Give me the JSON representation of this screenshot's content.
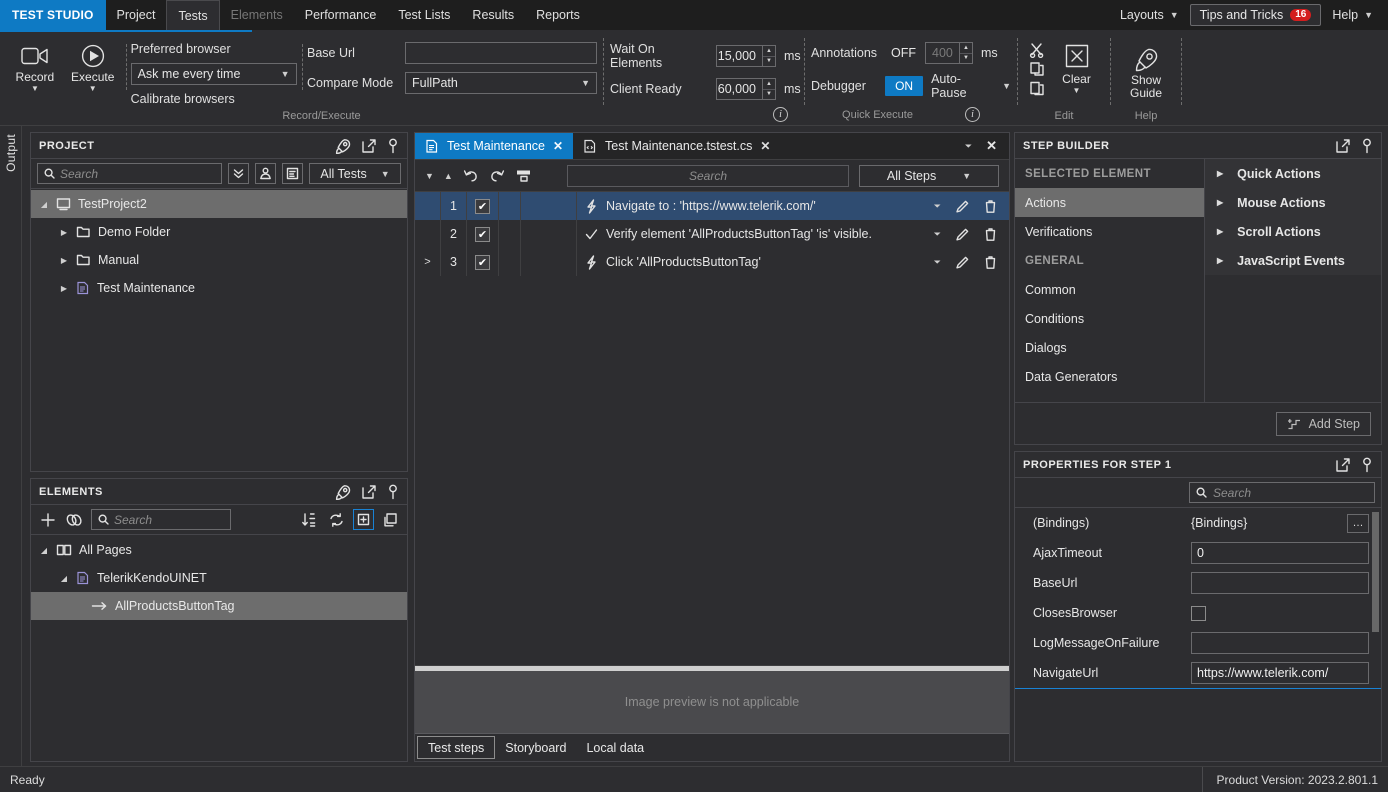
{
  "app": {
    "brand": "TEST STUDIO",
    "status_left": "Ready",
    "status_right": "Product Version: 2023.2.801.1"
  },
  "menu": {
    "items": [
      {
        "label": "Project",
        "state": "normal"
      },
      {
        "label": "Tests",
        "state": "active"
      },
      {
        "label": "Elements",
        "state": "disabled"
      },
      {
        "label": "Performance",
        "state": "normal"
      },
      {
        "label": "Test Lists",
        "state": "normal"
      },
      {
        "label": "Results",
        "state": "normal"
      },
      {
        "label": "Reports",
        "state": "normal"
      }
    ],
    "layouts_label": "Layouts",
    "tips_label": "Tips and Tricks",
    "tips_count": "16",
    "help_label": "Help"
  },
  "ribbon": {
    "record": {
      "label": "Record"
    },
    "execute": {
      "label": "Execute"
    },
    "browser": {
      "preferred_label": "Preferred browser",
      "preferred_value": "Ask me every time",
      "calibrate_label": "Calibrate browsers"
    },
    "urls": {
      "base_url_label": "Base Url",
      "base_url_value": "",
      "compare_mode_label": "Compare Mode",
      "compare_mode_value": "FullPath"
    },
    "timeouts": {
      "wait_label": "Wait On Elements",
      "wait_value": "15,000",
      "wait_unit": "ms",
      "client_label": "Client Ready",
      "client_value": "60,000",
      "client_unit": "ms"
    },
    "quick": {
      "annotations_label": "Annotations",
      "annotations_value": "OFF",
      "annotations_delay": "400",
      "annotations_unit": "ms",
      "debugger_label": "Debugger",
      "debugger_value": "ON",
      "autopause_label": "Auto-Pause"
    },
    "edit": {
      "clear_label": "Clear",
      "group_label": "Edit"
    },
    "help": {
      "show_guide_label": "Show\nGuide",
      "show_guide_line1": "Show",
      "show_guide_line2": "Guide",
      "group_label": "Help"
    },
    "group_labels": {
      "record_execute": "Record/Execute",
      "quick_execute": "Quick Execute"
    }
  },
  "output_rail": {
    "label": "Output"
  },
  "project_panel": {
    "title": "PROJECT",
    "search_placeholder": "Search",
    "filter_value": "All Tests",
    "tree": [
      {
        "label": "TestProject2",
        "icon": "project-icon",
        "depth": 0,
        "selected": true,
        "twisty": "open"
      },
      {
        "label": "Demo Folder",
        "icon": "folder-icon",
        "depth": 1,
        "selected": false,
        "twisty": "closed"
      },
      {
        "label": "Manual",
        "icon": "folder-icon",
        "depth": 1,
        "selected": false,
        "twisty": "closed"
      },
      {
        "label": "Test Maintenance",
        "icon": "test-icon",
        "depth": 1,
        "selected": false,
        "twisty": "closed"
      }
    ]
  },
  "elements_panel": {
    "title": "ELEMENTS",
    "search_placeholder": "Search",
    "tree": [
      {
        "label": "All Pages",
        "icon": "book-icon",
        "depth": 0,
        "selected": false,
        "twisty": "open"
      },
      {
        "label": "TelerikKendoUINET",
        "icon": "page-icon",
        "depth": 1,
        "selected": false,
        "twisty": "open"
      },
      {
        "label": "AllProductsButtonTag",
        "icon": "arrow-icon",
        "depth": 2,
        "selected": true,
        "twisty": "none"
      }
    ]
  },
  "center": {
    "tabs": [
      {
        "label": "Test Maintenance",
        "active": true,
        "icon": "test-file-icon"
      },
      {
        "label": "Test Maintenance.tstest.cs",
        "active": false,
        "icon": "code-file-icon"
      }
    ],
    "steps_search_placeholder": "Search",
    "steps_filter_value": "All Steps",
    "steps": [
      {
        "num": "1",
        "checked": true,
        "icon": "lightning-icon",
        "text": "Navigate to : 'https://www.telerik.com/'",
        "selected": true,
        "expander": false
      },
      {
        "num": "2",
        "checked": true,
        "icon": "check-icon",
        "text": "Verify element 'AllProductsButtonTag' 'is' visible.",
        "selected": false,
        "expander": false
      },
      {
        "num": "3",
        "checked": true,
        "icon": "lightning-icon",
        "text": "Click 'AllProductsButtonTag'",
        "selected": false,
        "expander": true
      }
    ],
    "preview_text": "Image preview is not applicable",
    "bottom_tabs": [
      {
        "label": "Test steps",
        "active": true
      },
      {
        "label": "Storyboard",
        "active": false
      },
      {
        "label": "Local data",
        "active": false
      }
    ]
  },
  "step_builder": {
    "title": "STEP BUILDER",
    "categories": [
      {
        "label": "SELECTED ELEMENT",
        "type": "header"
      },
      {
        "label": "Actions",
        "type": "item",
        "selected": true
      },
      {
        "label": "Verifications",
        "type": "item",
        "selected": false
      },
      {
        "label": "GENERAL",
        "type": "header"
      },
      {
        "label": "Common",
        "type": "item",
        "selected": false
      },
      {
        "label": "Conditions",
        "type": "item",
        "selected": false
      },
      {
        "label": "Dialogs",
        "type": "item",
        "selected": false
      },
      {
        "label": "Data Generators",
        "type": "item",
        "selected": false
      }
    ],
    "groups": [
      {
        "label": "Quick Actions"
      },
      {
        "label": "Mouse Actions"
      },
      {
        "label": "Scroll Actions"
      },
      {
        "label": "JavaScript Events"
      }
    ],
    "add_step_label": "Add Step"
  },
  "properties": {
    "title": "PROPERTIES FOR STEP 1",
    "search_placeholder": "Search",
    "rows": [
      {
        "key": "(Bindings)",
        "value": "{Bindings}",
        "kind": "bindings"
      },
      {
        "key": "AjaxTimeout",
        "value": "0",
        "kind": "text"
      },
      {
        "key": "BaseUrl",
        "value": "",
        "kind": "text"
      },
      {
        "key": "ClosesBrowser",
        "value": "",
        "kind": "checkbox"
      },
      {
        "key": "LogMessageOnFailure",
        "value": "",
        "kind": "text"
      },
      {
        "key": "NavigateUrl",
        "value": "https://www.telerik.com/",
        "kind": "text"
      }
    ]
  },
  "colors": {
    "accent": "#0e7ac4",
    "selection_blue": "#2f4c71",
    "selection_gray": "#6d6d6d",
    "badge_red": "#d41e1e",
    "window_bg": "#2d2d30"
  }
}
